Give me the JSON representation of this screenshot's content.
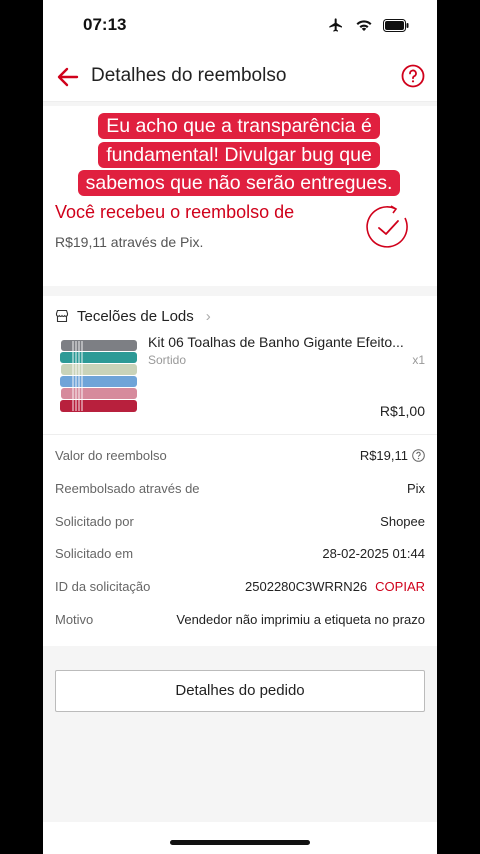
{
  "status_bar": {
    "time": "07:13"
  },
  "header": {
    "title": "Detalhes do reembolso"
  },
  "caption": {
    "lines": [
      "Eu acho que a transparência é",
      "fundamental! Divulgar bug que",
      "sabemos que não serão entregues."
    ]
  },
  "refund": {
    "title": "Você recebeu o reembolso de",
    "subtitle": "R$19,11 através de Pix."
  },
  "shop": {
    "name": "Tecelões de Lods"
  },
  "product": {
    "name": "Kit 06 Toalhas de Banho Gigante Efeito...",
    "variant": "Sortido",
    "quantity": "x1",
    "price": "R$1,00"
  },
  "details": [
    {
      "label": "Valor do reembolso",
      "value": "R$19,11"
    },
    {
      "label": "Reembolsado através de",
      "value": "Pix"
    },
    {
      "label": "Solicitado por",
      "value": "Shopee"
    },
    {
      "label": "Solicitado em",
      "value": "28-02-2025 01:44"
    },
    {
      "label": "ID da solicitação",
      "value": "2502280C3WRRN26",
      "action": "COPIAR"
    },
    {
      "label": "Motivo",
      "value": "Vendedor não imprimiu a etiqueta no prazo"
    }
  ],
  "order_button": {
    "label": "Detalhes do pedido"
  },
  "colors": {
    "accent": "#d0011b",
    "caption_bg": "#e0203f"
  }
}
